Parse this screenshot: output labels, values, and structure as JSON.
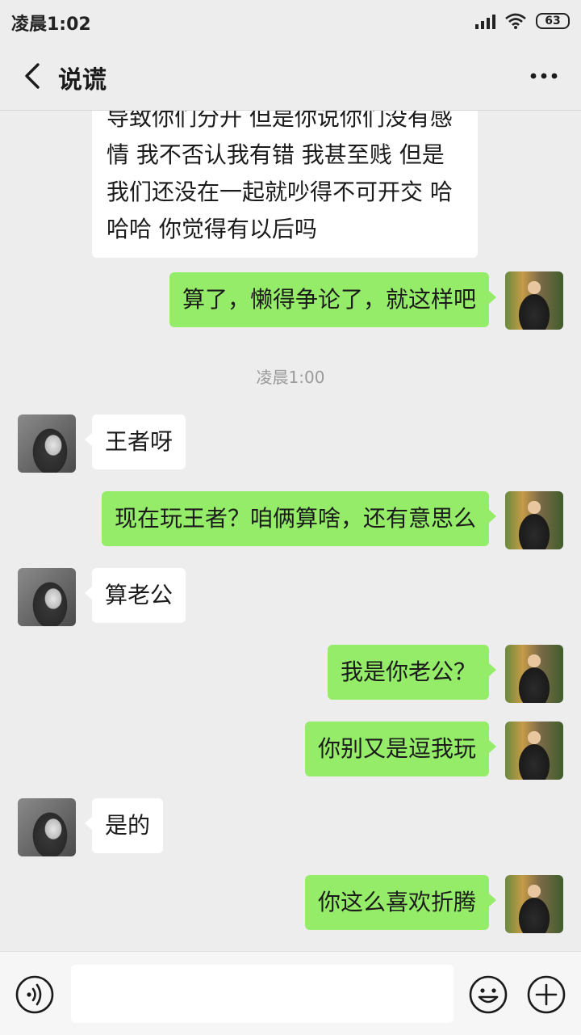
{
  "status": {
    "time": "凌晨1:02",
    "battery": "63"
  },
  "header": {
    "title": "说谎"
  },
  "messages": {
    "m0": "导致你们分开 但是你说你们没有感情 我不否认我有错 我甚至贱 但是我们还没在一起就吵得不可开交 哈哈哈 你觉得有以后吗",
    "m1": "算了，懒得争论了，就这样吧",
    "timestamp": "凌晨1:00",
    "m2": "王者呀",
    "m3": "现在玩王者？咱俩算啥，还有意思么",
    "m4": "算老公",
    "m5": "我是你老公？",
    "m6": "你别又是逗我玩",
    "m7": "是的",
    "m8": "你这么喜欢折腾"
  },
  "input": {
    "placeholder": "",
    "value": ""
  },
  "icons": {
    "back": "chevron-left-icon",
    "more": "more-dots-icon",
    "voice": "voice-icon",
    "emoji": "emoji-icon",
    "plus": "plus-icon"
  },
  "colors": {
    "outgoing_bubble": "#95ec69",
    "incoming_bubble": "#ffffff",
    "background": "#ededed"
  }
}
